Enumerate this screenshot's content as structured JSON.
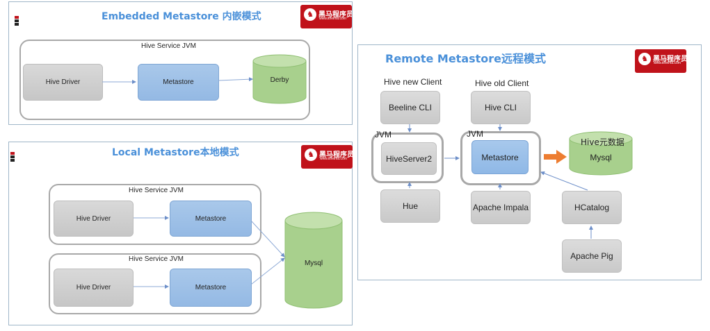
{
  "colors": {
    "logo_red": "#c0121a",
    "title_blue": "#4a90d9",
    "box_gray": "#cfcfcf",
    "box_blue": "#9fc0e8",
    "db_green": "#a8d08d",
    "arrow_orange": "#ed7d31",
    "connector_blue": "#8eaad6",
    "jvm_border": "#a8a8a8"
  },
  "logo": {
    "icon": "horse-icon",
    "brand": "黑马程序员",
    "domain": "www.itheima.com",
    "tagline": "传智播客旗下高端IT教育品牌"
  },
  "embedded": {
    "title": "Embedded Metastore 内嵌模式",
    "jvm_label": "Hive Service JVM",
    "driver": "Hive Driver",
    "metastore": "Metastore",
    "db": "Derby"
  },
  "local": {
    "title": "Local Metastore本地模式",
    "jvm1_label": "Hive Service JVM",
    "jvm1_driver": "Hive Driver",
    "jvm1_metastore": "Metastore",
    "jvm2_label": "Hive Service JVM",
    "jvm2_driver": "Hive Driver",
    "jvm2_metastore": "Metastore",
    "db": "Mysql"
  },
  "remote": {
    "title": "Remote Metastore远程模式",
    "new_client_label": "Hive new Client",
    "old_client_label": "Hive old Client",
    "beeline": "Beeline CLI",
    "hive_cli": "Hive CLI",
    "jvm_left_label": "JVM",
    "jvm_right_label": "JVM",
    "hiveserver2": "HiveServer2",
    "metastore": "Metastore",
    "db_label": "Hive元数据",
    "db": "Mysql",
    "hue": "Hue",
    "impala": "Apache Impala",
    "hcatalog": "HCatalog",
    "pig": "Apache Pig"
  }
}
